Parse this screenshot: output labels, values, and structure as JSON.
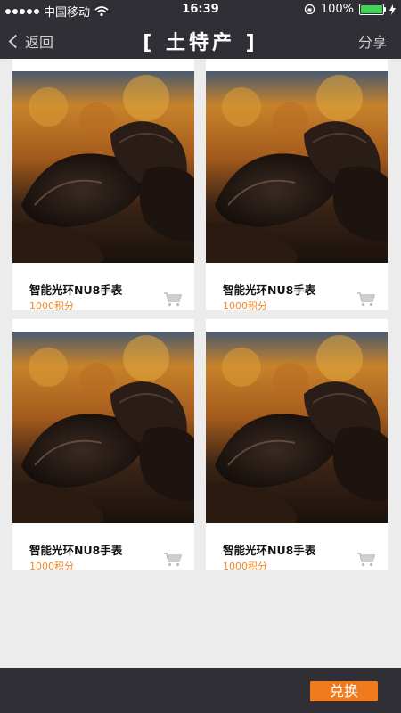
{
  "status_bar": {
    "carrier": "中国移动",
    "time": "16:39",
    "battery": "100%"
  },
  "nav": {
    "back_label": "返回",
    "title": "[ 土特产 ]",
    "share_label": "分享"
  },
  "products": [
    {
      "name": "智能光环NU8手表",
      "points": "1000积分"
    },
    {
      "name": "智能光环NU8手表",
      "points": "1000积分"
    },
    {
      "name": "智能光环NU8手表",
      "points": "1000积分"
    },
    {
      "name": "智能光环NU8手表",
      "points": "1000积分"
    }
  ],
  "footer": {
    "exchange_label": "兑换"
  },
  "colors": {
    "bar": "#2f2f35",
    "accent": "#f07a1e",
    "points": "#f08a28"
  },
  "icons": {
    "back": "chevron-left-icon",
    "wifi": "wifi-icon",
    "cart": "cart-icon"
  }
}
